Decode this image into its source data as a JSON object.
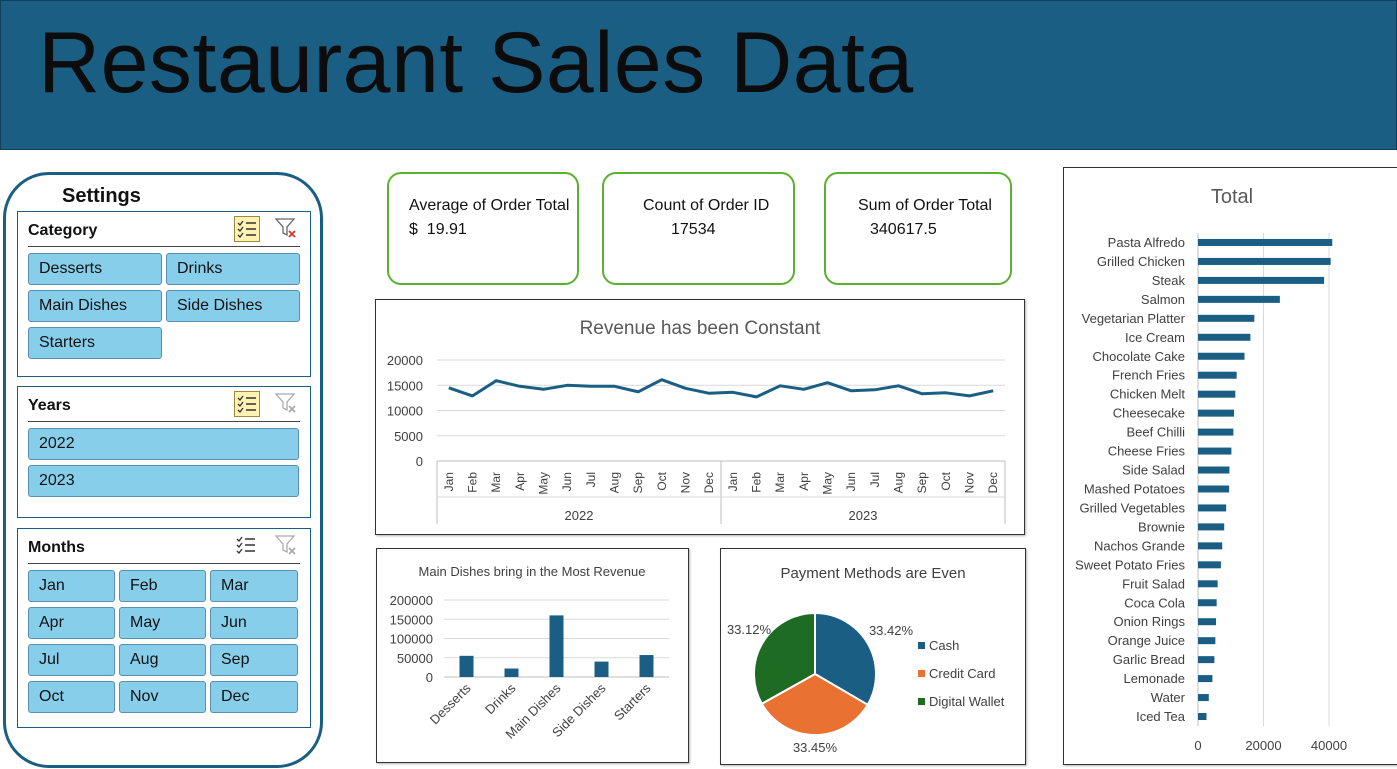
{
  "title": "Restaurant Sales Data",
  "settings": {
    "title": "Settings",
    "category": {
      "label": "Category",
      "items": [
        "Desserts",
        "Drinks",
        "Main Dishes",
        "Side Dishes",
        "Starters"
      ]
    },
    "years": {
      "label": "Years",
      "items": [
        "2022",
        "2023"
      ]
    },
    "months": {
      "label": "Months",
      "items": [
        "Jan",
        "Feb",
        "Mar",
        "Apr",
        "May",
        "Jun",
        "Jul",
        "Aug",
        "Sep",
        "Oct",
        "Nov",
        "Dec"
      ]
    }
  },
  "kpis": [
    {
      "label": "Average of Order Total",
      "value": "$  19.91"
    },
    {
      "label": "Count of Order ID",
      "value": "17534"
    },
    {
      "label": "Sum of Order Total",
      "value": "340617.5"
    }
  ],
  "colors": {
    "banner": "#1a5e84",
    "series": "#1a5e84",
    "cash": "#1a5e84",
    "credit": "#e97132",
    "wallet": "#1e6b24",
    "slicer_button": "#87ceeb",
    "card_border": "#5bb12f"
  },
  "chart_data": [
    {
      "type": "line",
      "title": "Revenue has been Constant",
      "x": [
        "Jan",
        "Feb",
        "Mar",
        "Apr",
        "May",
        "Jun",
        "Jul",
        "Aug",
        "Sep",
        "Oct",
        "Nov",
        "Dec",
        "Jan",
        "Feb",
        "Mar",
        "Apr",
        "May",
        "Jun",
        "Jul",
        "Aug",
        "Sep",
        "Oct",
        "Nov",
        "Dec"
      ],
      "groups": [
        {
          "label": "2022",
          "count": 12
        },
        {
          "label": "2023",
          "count": 12
        }
      ],
      "values": [
        14500,
        12900,
        15900,
        14800,
        14200,
        15000,
        14800,
        14800,
        13700,
        16100,
        14400,
        13400,
        13600,
        12700,
        14900,
        14200,
        15500,
        13900,
        14100,
        14900,
        13300,
        13500,
        12900,
        13900
      ],
      "ylim": [
        0,
        20000
      ],
      "yticks": [
        0,
        5000,
        10000,
        15000,
        20000
      ],
      "grid": true
    },
    {
      "type": "bar",
      "title": "Main Dishes bring in the Most Revenue",
      "categories": [
        "Desserts",
        "Drinks",
        "Main Dishes",
        "Side Dishes",
        "Starters"
      ],
      "values": [
        55000,
        22000,
        160000,
        40000,
        57000
      ],
      "ylim": [
        0,
        200000
      ],
      "yticks": [
        0,
        50000,
        100000,
        150000,
        200000
      ],
      "grid": true
    },
    {
      "type": "pie",
      "title": "Payment Methods are Even",
      "labels": [
        "Cash",
        "Credit Card",
        "Digital Wallet"
      ],
      "values": [
        33.42,
        33.45,
        33.12
      ],
      "data_labels": [
        "33.42%",
        "33.45%",
        "33.12%"
      ],
      "legend": "right"
    },
    {
      "type": "bar",
      "orientation": "horizontal",
      "title": "Total",
      "categories": [
        "Pasta Alfredo",
        "Grilled Chicken",
        "Steak",
        "Salmon",
        "Vegetarian Platter",
        "Ice Cream",
        "Chocolate Cake",
        "French Fries",
        "Chicken Melt",
        "Cheesecake",
        "Beef Chilli",
        "Cheese Fries",
        "Side Salad",
        "Mashed Potatoes",
        "Grilled Vegetables",
        "Brownie",
        "Nachos Grande",
        "Sweet Potato Fries",
        "Fruit Salad",
        "Coca Cola",
        "Onion Rings",
        "Orange Juice",
        "Garlic Bread",
        "Lemonade",
        "Water",
        "Iced Tea"
      ],
      "values": [
        41000,
        40500,
        38500,
        25000,
        17200,
        16000,
        14200,
        11800,
        11400,
        11000,
        10800,
        10200,
        9600,
        9500,
        8600,
        8000,
        7400,
        7000,
        6000,
        5700,
        5500,
        5300,
        5000,
        4400,
        3300,
        2600
      ],
      "xlim": [
        0,
        40000
      ],
      "xticks": [
        0,
        20000,
        40000
      ],
      "grid": true
    }
  ]
}
